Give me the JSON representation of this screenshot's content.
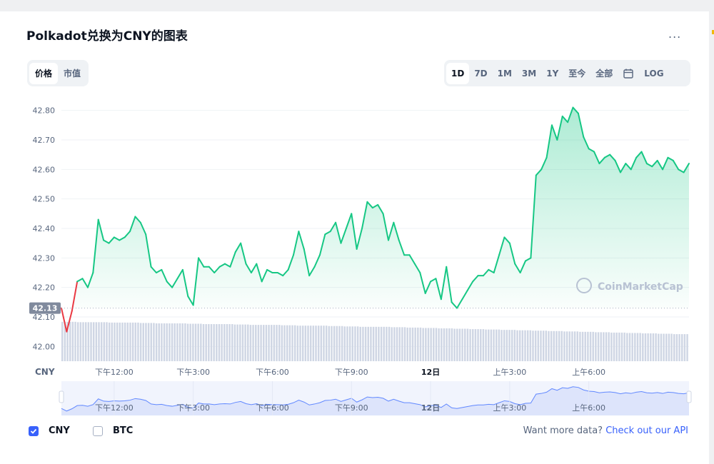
{
  "header": {
    "title": "Polkadot兑换为CNY的图表",
    "more_label": "..."
  },
  "view_toggle": [
    {
      "label": "价格",
      "active": true
    },
    {
      "label": "市值",
      "active": false
    }
  ],
  "range_buttons": [
    "1D",
    "7D",
    "1M",
    "3M",
    "1Y",
    "至今",
    "全部"
  ],
  "range_active": "1D",
  "calendar_icon": "calendar-icon",
  "log_label": "LOG",
  "legend": [
    {
      "label": "CNY",
      "checked": true
    },
    {
      "label": "BTC",
      "checked": false
    }
  ],
  "footer": {
    "want_text": "Want more data?",
    "api_link": "Check out our API"
  },
  "watermark": "CoinMarketCap",
  "colors": {
    "up": "#16c784",
    "down": "#ea3943",
    "accent": "#3861fb",
    "volume": "#cfd6e4"
  },
  "chart_data": {
    "type": "line",
    "currency_label": "CNY",
    "ylim": [
      41.95,
      42.85
    ],
    "yticks": [
      "42.80",
      "42.70",
      "42.60",
      "42.50",
      "42.40",
      "42.30",
      "42.20",
      "42.10",
      "42.00"
    ],
    "reference_price": 42.13,
    "reference_label": "42.13",
    "xticks": [
      "下午12:00",
      "下午3:00",
      "下午6:00",
      "下午9:00",
      "12日",
      "上午3:00",
      "上午6:00"
    ],
    "xtick_hours": [
      2.0,
      5.0,
      8.0,
      11.0,
      14.0,
      17.0,
      20.0
    ],
    "x_range_hours": [
      0,
      23.8
    ],
    "series": [
      {
        "hours": [
          0.0,
          0.2,
          0.4,
          0.6,
          0.8,
          1.0,
          1.2,
          1.4,
          1.6,
          1.8,
          2.0,
          2.2,
          2.4,
          2.6,
          2.8,
          3.0,
          3.2,
          3.4,
          3.6,
          3.8,
          4.0,
          4.2,
          4.4,
          4.6,
          4.8,
          5.0,
          5.2,
          5.4,
          5.6,
          5.8,
          6.0,
          6.2,
          6.4,
          6.6,
          6.8,
          7.0,
          7.2,
          7.4,
          7.6,
          7.8,
          8.0,
          8.2,
          8.4,
          8.6,
          8.8,
          9.0,
          9.2,
          9.4,
          9.6,
          9.8,
          10.0,
          10.2,
          10.4,
          10.6,
          10.8,
          11.0,
          11.2,
          11.4,
          11.6,
          11.8,
          12.0,
          12.2,
          12.4,
          12.6,
          12.8,
          13.0,
          13.2,
          13.4,
          13.6,
          13.8,
          14.0,
          14.2,
          14.4,
          14.6,
          14.8,
          15.0,
          15.2,
          15.4,
          15.6,
          15.8,
          16.0,
          16.2,
          16.4,
          16.6,
          16.8,
          17.0,
          17.2,
          17.4,
          17.6,
          17.8,
          18.0,
          18.2,
          18.4,
          18.6,
          18.8,
          19.0,
          19.2,
          19.4,
          19.6,
          19.8,
          20.0,
          20.2,
          20.4,
          20.6,
          20.8,
          21.0,
          21.2,
          21.4,
          21.6,
          21.8,
          22.0,
          22.2,
          22.4,
          22.6,
          22.8,
          23.0,
          23.2,
          23.4,
          23.6,
          23.8
        ],
        "values": [
          42.13,
          42.05,
          42.12,
          42.22,
          42.23,
          42.2,
          42.25,
          42.43,
          42.36,
          42.35,
          42.37,
          42.36,
          42.37,
          42.39,
          42.44,
          42.42,
          42.38,
          42.27,
          42.25,
          42.26,
          42.22,
          42.2,
          42.23,
          42.26,
          42.17,
          42.14,
          42.3,
          42.27,
          42.27,
          42.25,
          42.27,
          42.28,
          42.27,
          42.32,
          42.35,
          42.28,
          42.25,
          42.28,
          42.22,
          42.26,
          42.25,
          42.25,
          42.24,
          42.26,
          42.31,
          42.39,
          42.33,
          42.24,
          42.27,
          42.31,
          42.38,
          42.39,
          42.42,
          42.35,
          42.4,
          42.45,
          42.33,
          42.4,
          42.49,
          42.47,
          42.48,
          42.45,
          42.36,
          42.42,
          42.36,
          42.31,
          42.31,
          42.28,
          42.25,
          42.18,
          42.22,
          42.23,
          42.16,
          42.27,
          42.15,
          42.13,
          42.16,
          42.19,
          42.22,
          42.24,
          42.24,
          42.26,
          42.25,
          42.31,
          42.37,
          42.35,
          42.28,
          42.25,
          42.29,
          42.3,
          42.58,
          42.6,
          42.64,
          42.75,
          42.7,
          42.78,
          42.76,
          42.81,
          42.79,
          42.71,
          42.67,
          42.66,
          42.62,
          42.64,
          42.65,
          42.63,
          42.59,
          42.62,
          42.6,
          42.64,
          42.66,
          42.62,
          42.61,
          42.63,
          42.6,
          42.64,
          42.63,
          42.6,
          42.59,
          42.62
        ]
      }
    ],
    "volume_relative": [
      0.8,
      0.79,
      0.79,
      0.78,
      0.78,
      0.77,
      0.76,
      0.76,
      0.75,
      0.74,
      0.74,
      0.73,
      0.72,
      0.72,
      0.71,
      0.7,
      0.7,
      0.69,
      0.68,
      0.67,
      0.67,
      0.66,
      0.65,
      0.64,
      0.63,
      0.62,
      0.61,
      0.6,
      0.59,
      0.58,
      0.57,
      0.56,
      0.55,
      0.54,
      0.53,
      0.52,
      0.51,
      0.5,
      0.49,
      0.48
    ],
    "navigator_ticks": [
      "下午12:00",
      "下午3:00",
      "下午6:00",
      "下午9:00",
      "12日",
      "上午3:00",
      "上午6:00"
    ]
  }
}
